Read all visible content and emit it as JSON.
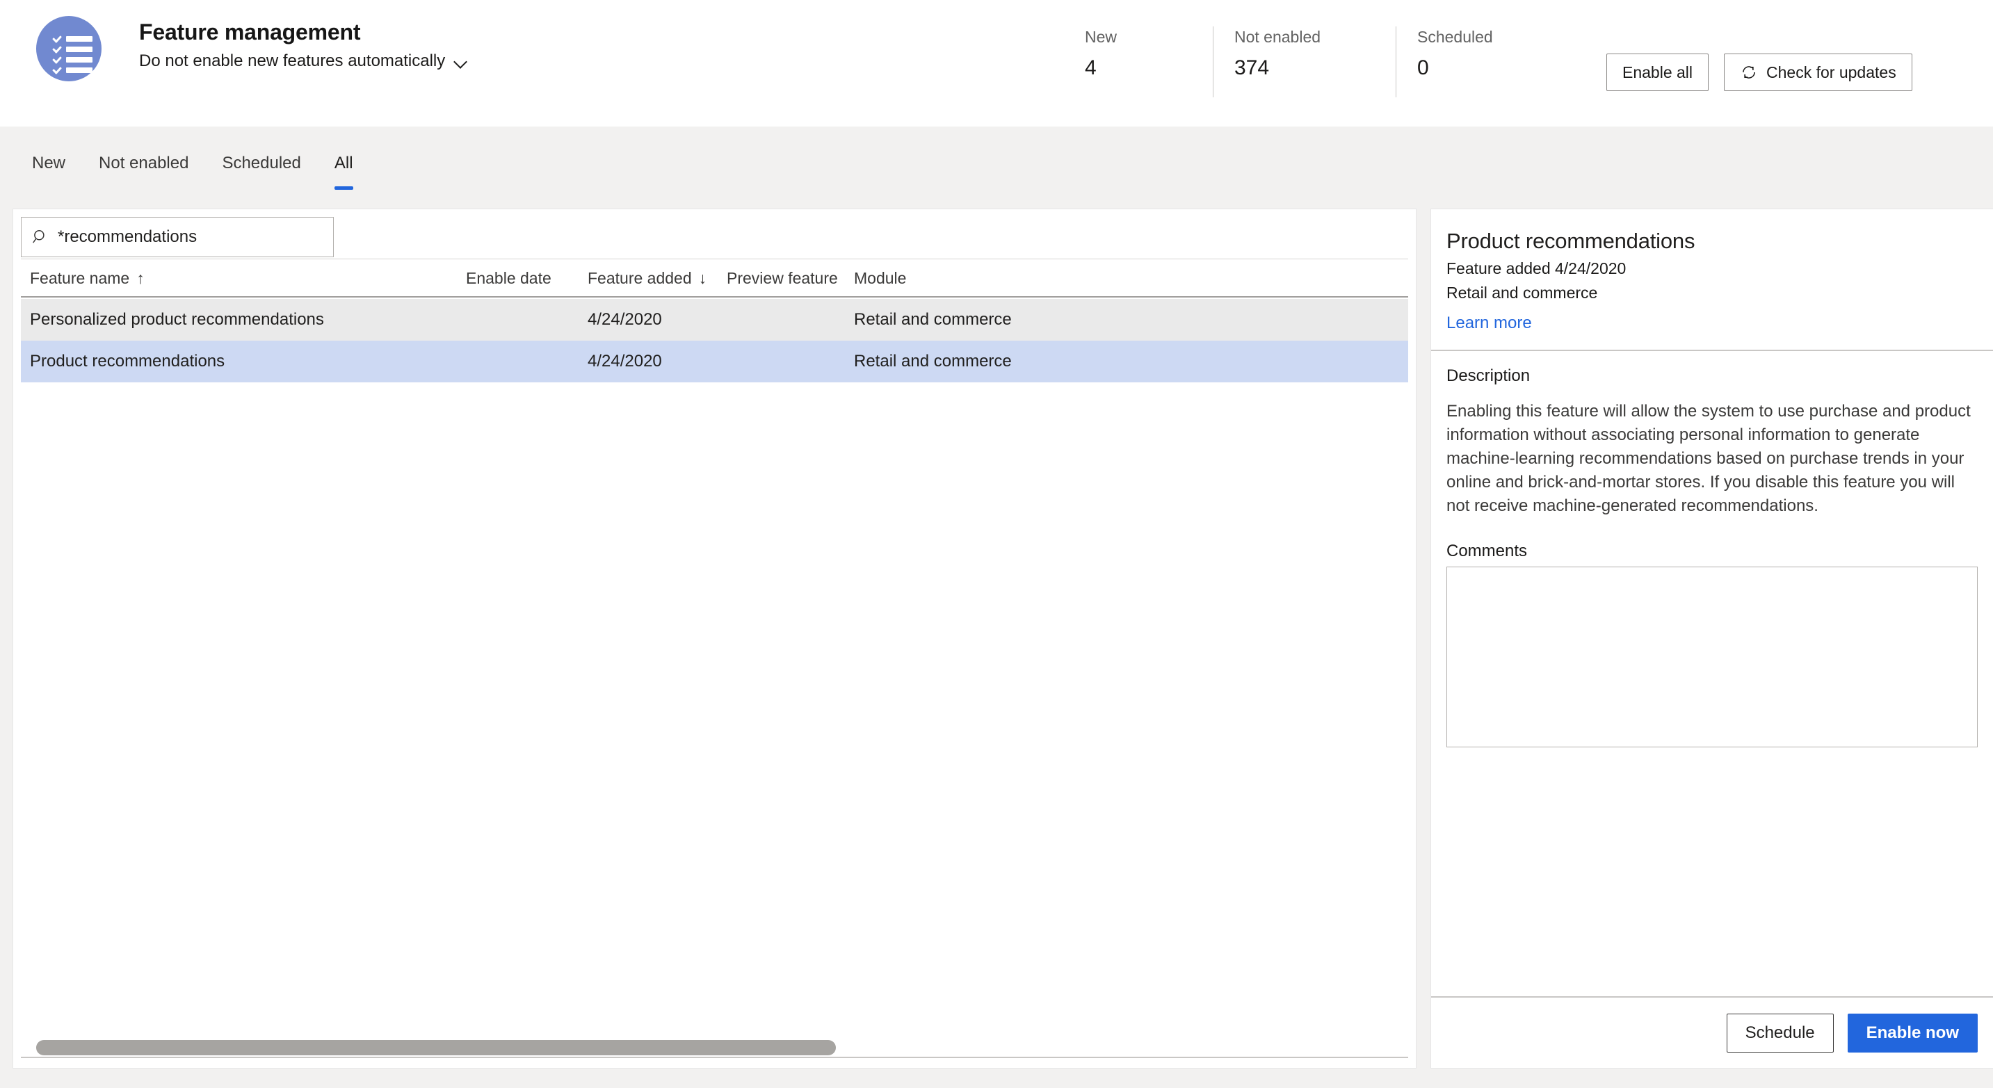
{
  "header": {
    "app_icon": "checklist-icon",
    "icon_color": "#7189d0",
    "title": "Feature management",
    "subtitle": "Do not enable new features automatically",
    "subtitle_chevron": "chevron-down-icon",
    "stats": [
      {
        "label": "New",
        "value": "4"
      },
      {
        "label": "Not enabled",
        "value": "374"
      },
      {
        "label": "Scheduled",
        "value": "0"
      }
    ],
    "buttons": {
      "enable_all": "Enable all",
      "check_updates": "Check for updates",
      "check_updates_icon": "refresh-icon"
    }
  },
  "tabs": [
    {
      "label": "New",
      "active": false
    },
    {
      "label": "Not enabled",
      "active": false
    },
    {
      "label": "Scheduled",
      "active": false
    },
    {
      "label": "All",
      "active": true
    }
  ],
  "accent_color": "#2266dd",
  "left_panel": {
    "search": {
      "icon": "search-icon",
      "value": "*recommendations",
      "placeholder": "Filter"
    },
    "columns": [
      {
        "label": "Feature name",
        "sort": "↑"
      },
      {
        "label": "Enable date",
        "sort": ""
      },
      {
        "label": "Feature added",
        "sort": "↓"
      },
      {
        "label": "Preview feature",
        "sort": ""
      },
      {
        "label": "Module",
        "sort": ""
      }
    ],
    "rows": [
      {
        "feature_name": "Personalized product recommendations",
        "enable_date": "",
        "feature_added": "4/24/2020",
        "preview_feature": "",
        "module": "Retail and commerce",
        "state": "hover"
      },
      {
        "feature_name": "Product recommendations",
        "enable_date": "",
        "feature_added": "4/24/2020",
        "preview_feature": "",
        "module": "Retail and commerce",
        "state": "selected"
      }
    ]
  },
  "detail_panel": {
    "title": "Product recommendations",
    "feature_added": "Feature added 4/24/2020",
    "module": "Retail and commerce",
    "learn_more": "Learn more",
    "description_label": "Description",
    "description": "Enabling this feature will allow the system to use purchase and product information without associating personal information to generate machine-learning recommendations based on purchase trends in your online and brick-and-mortar stores. If you disable this feature you will not receive machine-generated recommendations.",
    "comments_label": "Comments",
    "comments_value": "",
    "footer": {
      "schedule": "Schedule",
      "enable_now": "Enable now"
    }
  }
}
